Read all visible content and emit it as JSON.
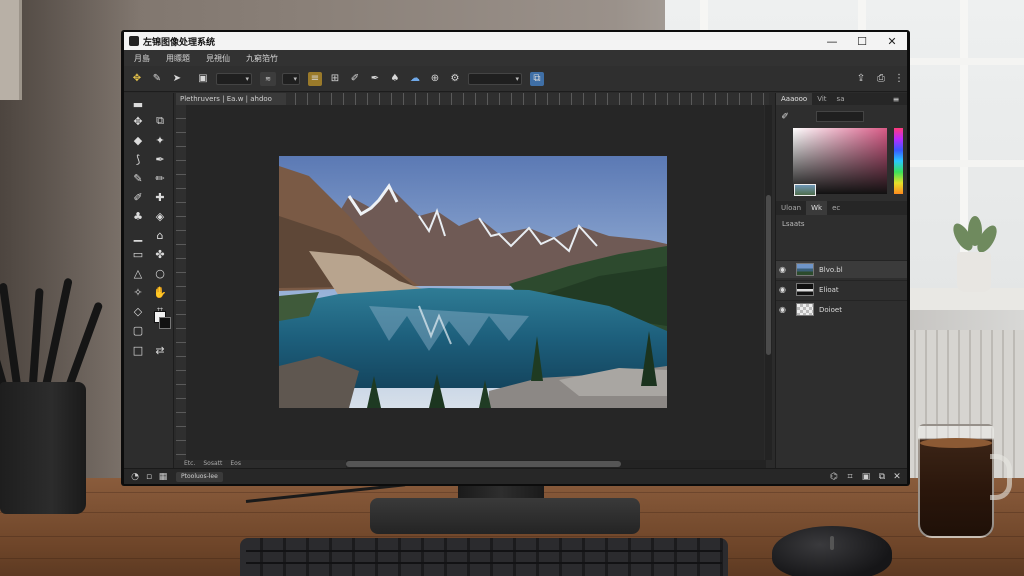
{
  "window": {
    "title": "左锦图像处理系统"
  },
  "controls": {
    "minimize": "—",
    "maximize": "☐",
    "close": "✕"
  },
  "menu": [
    "月島",
    "用瞟題",
    "見視仙",
    "九窮箔竹"
  ],
  "document_tab": "Plethruvers | Ea.w | ahdoo",
  "panels": {
    "color_tabs": [
      "Aaaooo",
      "Vit",
      "sa"
    ],
    "layers_tabs": [
      "Uloan",
      "Wk",
      "ec"
    ],
    "layers_header": "Lsaats",
    "layers": [
      {
        "name": "Blvo.bl"
      },
      {
        "name": "Elioat"
      },
      {
        "name": "Doioet"
      }
    ]
  },
  "status": {
    "zoom_info": [
      "Etc.",
      "Sosatt",
      "Eos"
    ],
    "tab_chip": "Ptooluos-lee"
  },
  "colors": {
    "accent": "#3f6fa6",
    "titlebar": "#f3f3f3",
    "app_bg": "#2b2b2b"
  }
}
